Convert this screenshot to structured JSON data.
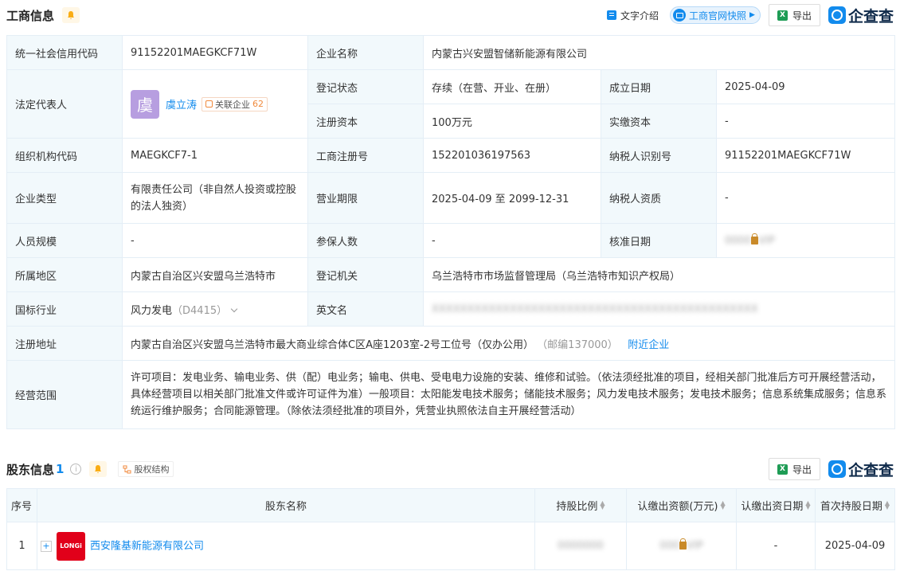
{
  "business": {
    "title": "工商信息",
    "text_intro": "文字介绍",
    "snapshot": "工商官网快照",
    "export": "导出",
    "brand": "企查查",
    "rows": {
      "credit_code_label": "统一社会信用代码",
      "credit_code": "91152201MAEGKCF71W",
      "company_name_label": "企业名称",
      "company_name": "内蒙古兴安盟智储新能源有限公司",
      "legal_rep_label": "法定代表人",
      "legal_rep_avatar": "虞",
      "legal_rep_name": "虞立涛",
      "related_label": "关联企业",
      "related_count": "62",
      "reg_status_label": "登记状态",
      "reg_status": "存续（在营、开业、在册）",
      "found_date_label": "成立日期",
      "found_date": "2025-04-09",
      "reg_capital_label": "注册资本",
      "reg_capital": "100万元",
      "paid_capital_label": "实缴资本",
      "paid_capital": "-",
      "org_code_label": "组织机构代码",
      "org_code": "MAEGKCF7-1",
      "biz_reg_no_label": "工商注册号",
      "biz_reg_no": "152201036197563",
      "taxpayer_id_label": "纳税人识别号",
      "taxpayer_id": "91152201MAEGKCF71W",
      "ent_type_label": "企业类型",
      "ent_type": "有限责任公司（非自然人投资或控股的法人独资）",
      "biz_term_label": "营业期限",
      "biz_term": "2025-04-09 至 2099-12-31",
      "taxpayer_qual_label": "纳税人资质",
      "taxpayer_qual": "-",
      "staff_size_label": "人员规模",
      "staff_size": "-",
      "insured_label": "参保人数",
      "insured": "-",
      "approval_date_label": "核准日期",
      "region_label": "所属地区",
      "region": "内蒙古自治区兴安盟乌兰浩特市",
      "reg_authority_label": "登记机关",
      "reg_authority": "乌兰浩特市市场监督管理局（乌兰浩特市知识产权局）",
      "industry_label": "国标行业",
      "industry": "风力发电",
      "industry_code": "（D4415）",
      "en_name_label": "英文名",
      "address_label": "注册地址",
      "address": "内蒙古自治区兴安盟乌兰浩特市最大商业综合体C区A座1203室-2号工位号（仅办公用）",
      "postcode": "（邮编137000）",
      "nearby": "附近企业",
      "scope_label": "经营范围",
      "scope": "许可项目：发电业务、输电业务、供（配）电业务；输电、供电、受电电力设施的安装、维修和试验。（依法须经批准的项目，经相关部门批准后方可开展经营活动，具体经营项目以相关部门批准文件或许可证件为准）一般项目：太阳能发电技术服务；储能技术服务；风力发电技术服务；发电技术服务；信息系统集成服务；信息系统运行维护服务；合同能源管理。（除依法须经批准的项目外，凭营业执照依法自主开展经营活动）"
    }
  },
  "shareholders": {
    "title": "股东信息",
    "count": "1",
    "equity_structure": "股权结构",
    "export": "导出",
    "brand": "企查查",
    "columns": [
      "序号",
      "股东名称",
      "持股比例",
      "认缴出资额(万元)",
      "认缴出资日期",
      "首次持股日期"
    ],
    "rows": [
      {
        "index": "1",
        "logo_text": "LONGi",
        "name": "西安隆基新能源有限公司",
        "subscribed_date": "-",
        "first_hold_date": "2025-04-09"
      }
    ]
  },
  "colors": {
    "accent": "#128bed",
    "label_bg": "#f2f9fc",
    "border": "#e4eef6",
    "warn": "#f08a3d"
  }
}
